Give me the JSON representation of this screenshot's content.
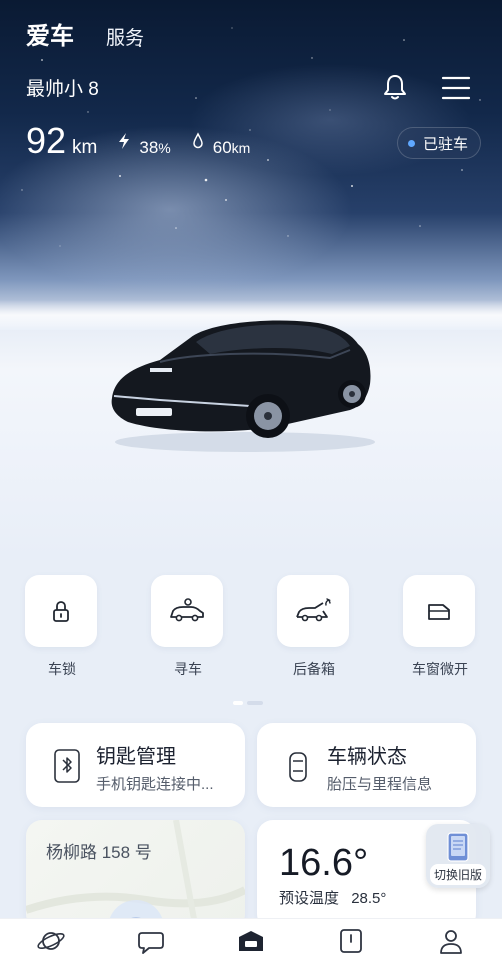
{
  "header": {
    "tabs": [
      {
        "label": "爱车",
        "active": true
      },
      {
        "label": "服务",
        "active": false
      }
    ],
    "car_name": "最帅小 8",
    "icons": [
      "bell-icon",
      "menu-icon"
    ]
  },
  "stats": {
    "range_value": "92",
    "range_unit": "km",
    "battery_value": "38",
    "battery_unit": "%",
    "fuel_value": "60",
    "fuel_unit": "km",
    "status": "已驻车"
  },
  "actions": [
    {
      "label": "车锁",
      "icon": "lock-icon"
    },
    {
      "label": "寻车",
      "icon": "find-car-icon"
    },
    {
      "label": "后备箱",
      "icon": "trunk-icon"
    },
    {
      "label": "车窗微开",
      "icon": "window-icon"
    }
  ],
  "cards": {
    "key": {
      "title": "钥匙管理",
      "subtitle": "手机钥匙连接中..."
    },
    "vehicle": {
      "title": "车辆状态",
      "subtitle": "胎压与里程信息"
    },
    "location": {
      "address": "杨柳路 158 号"
    },
    "climate": {
      "temperature": "16.6°",
      "preset_label": "预设温度",
      "preset_value": "28.5°"
    }
  },
  "floating": {
    "switch_label": "切换旧版"
  },
  "bottom_nav": [
    {
      "name": "discover",
      "icon": "planet-icon"
    },
    {
      "name": "community",
      "icon": "chat-icon"
    },
    {
      "name": "car",
      "icon": "car-home-icon",
      "active": true
    },
    {
      "name": "service",
      "icon": "card-icon"
    },
    {
      "name": "profile",
      "icon": "person-icon"
    }
  ],
  "colors": {
    "accent": "#5fa8ff",
    "text_dark": "#1c2230"
  }
}
